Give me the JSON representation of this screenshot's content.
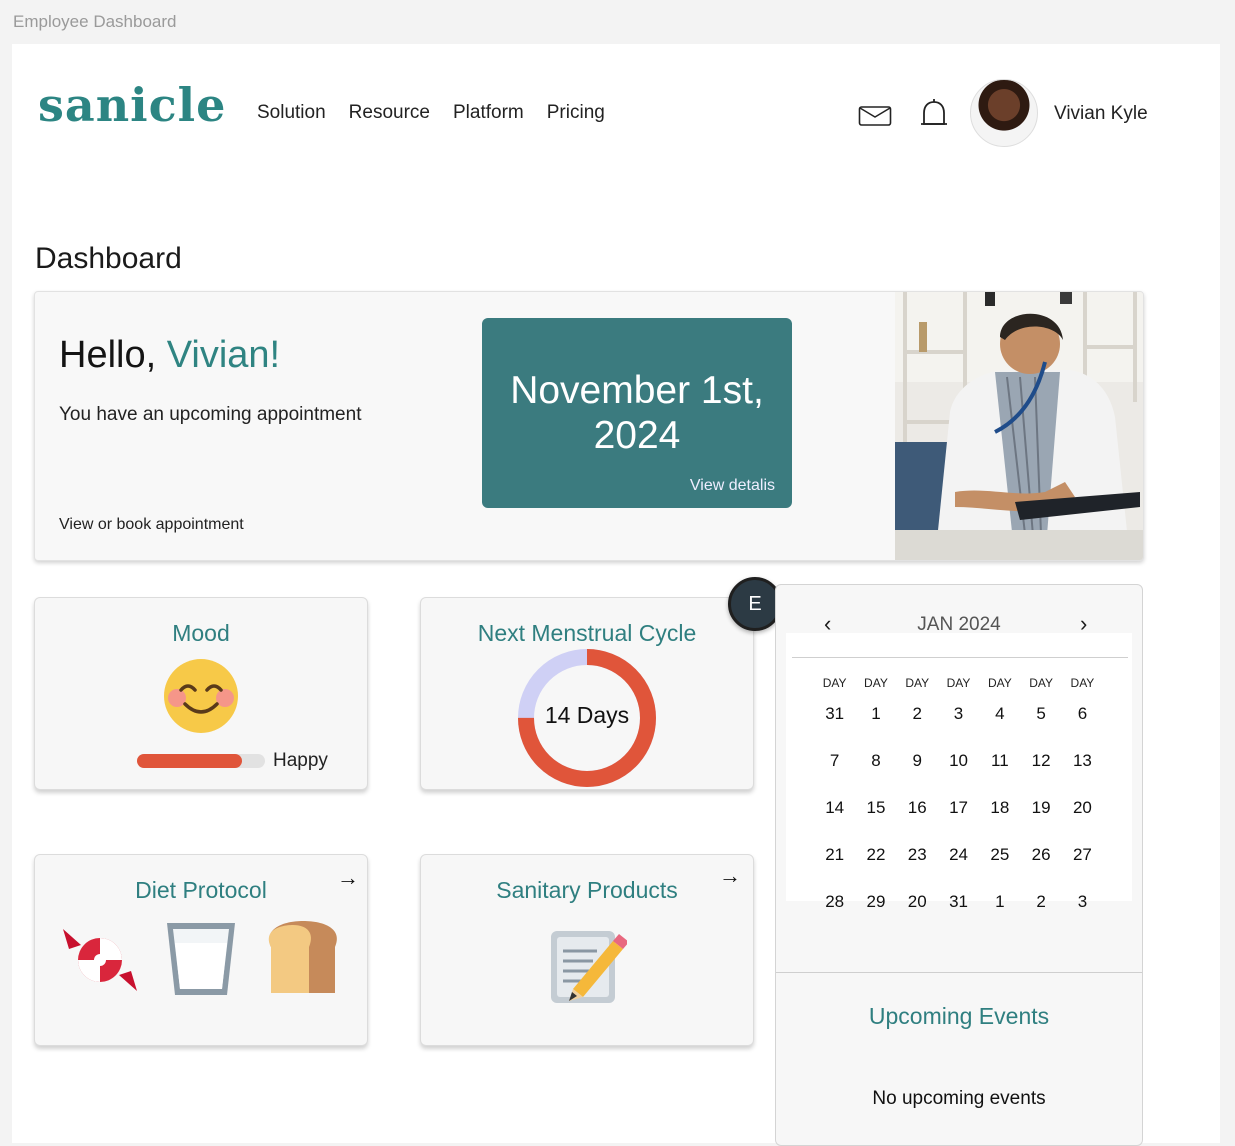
{
  "window": {
    "title": "Employee Dashboard"
  },
  "header": {
    "logo": "sanicle",
    "nav": [
      "Solution",
      "Resource",
      "Platform",
      "Pricing"
    ],
    "user_name": "Vivian Kyle"
  },
  "page_title": "Dashboard",
  "hero": {
    "greeting": "Hello, ",
    "name": "Vivian!",
    "message": "You have an upcoming appointment",
    "book_link": "View or book appointment",
    "appointment_date": "November 1st, 2024",
    "view_details": "View detalis"
  },
  "mood": {
    "title": "Mood",
    "label": "Happy",
    "level_percent": 82
  },
  "cycle": {
    "title": "Next Menstrual Cycle",
    "days_label": "14 Days",
    "progress_fraction": 0.75
  },
  "badge": {
    "letter": "E"
  },
  "diet": {
    "title": "Diet Protocol",
    "arrow": "→"
  },
  "sanitary": {
    "title": "Sanitary Products",
    "arrow": "→"
  },
  "calendar": {
    "month": "JAN 2024",
    "prev": "‹",
    "next": "›",
    "weekdays": [
      "DAY",
      "DAY",
      "DAY",
      "DAY",
      "DAY",
      "DAY",
      "DAY"
    ],
    "days": [
      "31",
      "1",
      "2",
      "3",
      "4",
      "5",
      "6",
      "7",
      "8",
      "9",
      "10",
      "11",
      "12",
      "13",
      "14",
      "15",
      "16",
      "17",
      "18",
      "19",
      "20",
      "21",
      "22",
      "23",
      "24",
      "25",
      "26",
      "27",
      "28",
      "29",
      "20",
      "31",
      "1",
      "2",
      "3"
    ]
  },
  "events": {
    "title": "Upcoming Events",
    "empty": "No upcoming events"
  },
  "colors": {
    "teal": "#3b7b7f",
    "accent": "#2f7f80",
    "orange": "#e0553a",
    "lavender": "#cfd0f5"
  }
}
